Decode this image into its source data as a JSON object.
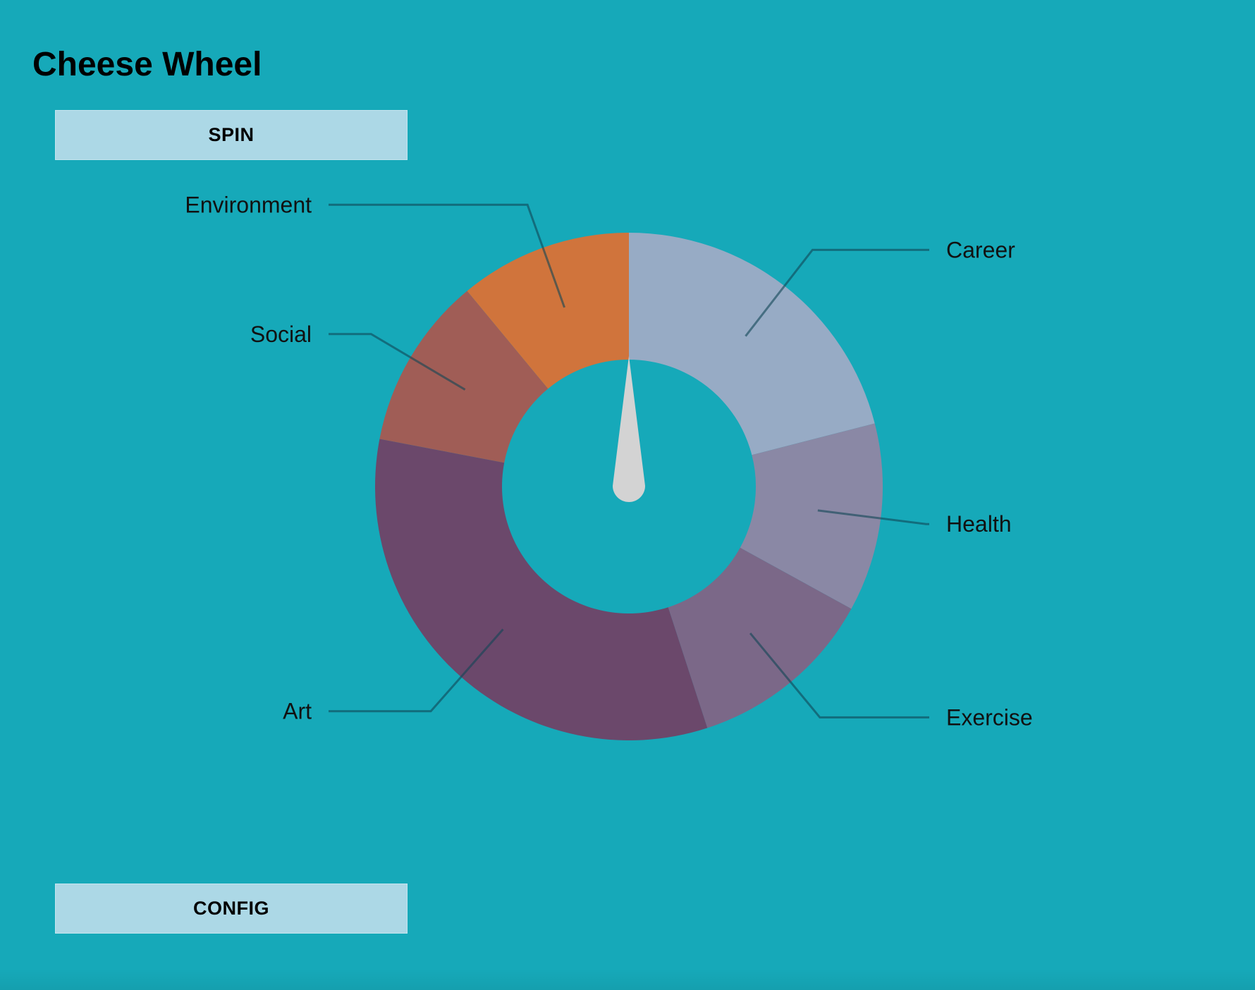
{
  "page": {
    "title": "Cheese Wheel"
  },
  "buttons": {
    "spin_label": "SPIN",
    "config_label": "CONFIG"
  },
  "colors": {
    "background": "#16a9b9",
    "button": "#acd8e6",
    "pointer": "#d3d3d3"
  },
  "chart_data": {
    "type": "pie",
    "donut": true,
    "start_angle_deg": 0,
    "pointer_angle_deg": 0,
    "slices": [
      {
        "name": "Career",
        "value": 21,
        "color": "#97abc5",
        "label_side": "right"
      },
      {
        "name": "Health",
        "value": 12,
        "color": "#8a88a5",
        "label_side": "right"
      },
      {
        "name": "Exercise",
        "value": 12,
        "color": "#7b6888",
        "label_side": "right"
      },
      {
        "name": "Art",
        "value": 33,
        "color": "#6b486b",
        "label_side": "left"
      },
      {
        "name": "Social",
        "value": 11,
        "color": "#a05d56",
        "label_side": "left"
      },
      {
        "name": "Environment",
        "value": 11,
        "color": "#d0743c",
        "label_side": "left"
      }
    ]
  }
}
